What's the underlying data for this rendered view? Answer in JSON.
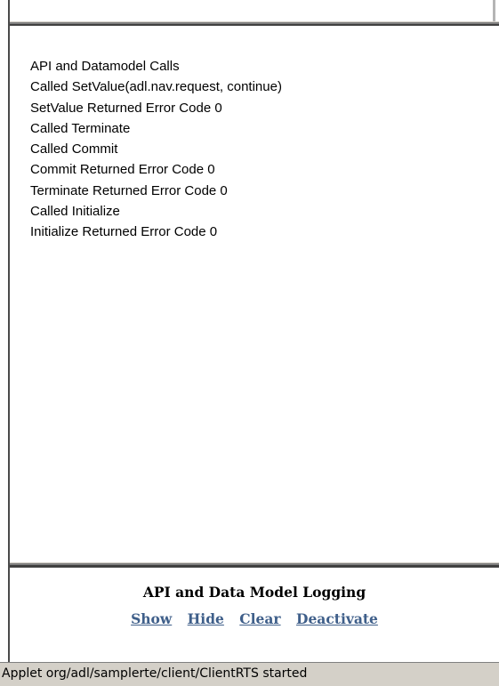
{
  "log": {
    "lines": [
      "API and Datamodel Calls",
      "Called SetValue(adl.nav.request, continue)",
      "SetValue Returned Error Code 0",
      "Called Terminate",
      "Called Commit",
      "Commit Returned Error Code 0",
      "Terminate Returned Error Code 0",
      "Called Initialize",
      "Initialize Returned Error Code 0"
    ]
  },
  "controls": {
    "title": "API and Data Model Logging",
    "links": {
      "show": "Show",
      "hide": "Hide",
      "clear": "Clear",
      "deactivate": "Deactivate"
    },
    "link_color": "#3f5f8a"
  },
  "status_bar": {
    "text": "Applet org/adl/samplerte/client/ClientRTS started",
    "background": "#d4d0c8"
  }
}
